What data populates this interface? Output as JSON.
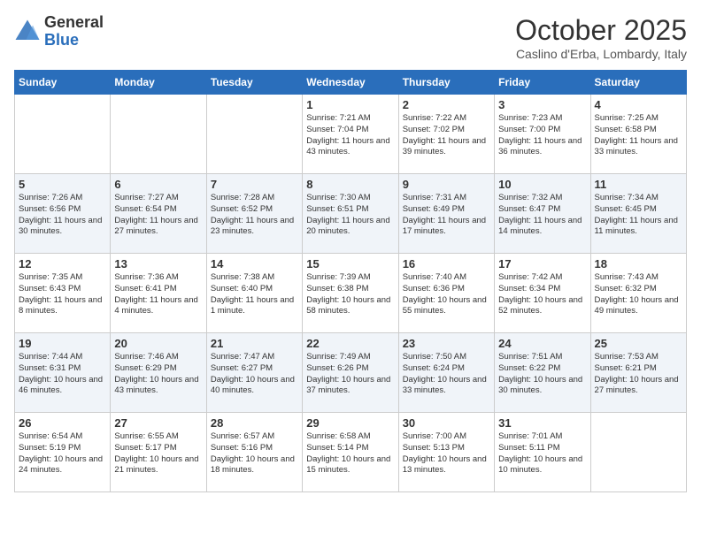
{
  "header": {
    "logo_general": "General",
    "logo_blue": "Blue",
    "month_title": "October 2025",
    "subtitle": "Caslino d'Erba, Lombardy, Italy"
  },
  "weekdays": [
    "Sunday",
    "Monday",
    "Tuesday",
    "Wednesday",
    "Thursday",
    "Friday",
    "Saturday"
  ],
  "weeks": [
    [
      {
        "day": "",
        "sunrise": "",
        "sunset": "",
        "daylight": ""
      },
      {
        "day": "",
        "sunrise": "",
        "sunset": "",
        "daylight": ""
      },
      {
        "day": "",
        "sunrise": "",
        "sunset": "",
        "daylight": ""
      },
      {
        "day": "1",
        "sunrise": "Sunrise: 7:21 AM",
        "sunset": "Sunset: 7:04 PM",
        "daylight": "Daylight: 11 hours and 43 minutes."
      },
      {
        "day": "2",
        "sunrise": "Sunrise: 7:22 AM",
        "sunset": "Sunset: 7:02 PM",
        "daylight": "Daylight: 11 hours and 39 minutes."
      },
      {
        "day": "3",
        "sunrise": "Sunrise: 7:23 AM",
        "sunset": "Sunset: 7:00 PM",
        "daylight": "Daylight: 11 hours and 36 minutes."
      },
      {
        "day": "4",
        "sunrise": "Sunrise: 7:25 AM",
        "sunset": "Sunset: 6:58 PM",
        "daylight": "Daylight: 11 hours and 33 minutes."
      }
    ],
    [
      {
        "day": "5",
        "sunrise": "Sunrise: 7:26 AM",
        "sunset": "Sunset: 6:56 PM",
        "daylight": "Daylight: 11 hours and 30 minutes."
      },
      {
        "day": "6",
        "sunrise": "Sunrise: 7:27 AM",
        "sunset": "Sunset: 6:54 PM",
        "daylight": "Daylight: 11 hours and 27 minutes."
      },
      {
        "day": "7",
        "sunrise": "Sunrise: 7:28 AM",
        "sunset": "Sunset: 6:52 PM",
        "daylight": "Daylight: 11 hours and 23 minutes."
      },
      {
        "day": "8",
        "sunrise": "Sunrise: 7:30 AM",
        "sunset": "Sunset: 6:51 PM",
        "daylight": "Daylight: 11 hours and 20 minutes."
      },
      {
        "day": "9",
        "sunrise": "Sunrise: 7:31 AM",
        "sunset": "Sunset: 6:49 PM",
        "daylight": "Daylight: 11 hours and 17 minutes."
      },
      {
        "day": "10",
        "sunrise": "Sunrise: 7:32 AM",
        "sunset": "Sunset: 6:47 PM",
        "daylight": "Daylight: 11 hours and 14 minutes."
      },
      {
        "day": "11",
        "sunrise": "Sunrise: 7:34 AM",
        "sunset": "Sunset: 6:45 PM",
        "daylight": "Daylight: 11 hours and 11 minutes."
      }
    ],
    [
      {
        "day": "12",
        "sunrise": "Sunrise: 7:35 AM",
        "sunset": "Sunset: 6:43 PM",
        "daylight": "Daylight: 11 hours and 8 minutes."
      },
      {
        "day": "13",
        "sunrise": "Sunrise: 7:36 AM",
        "sunset": "Sunset: 6:41 PM",
        "daylight": "Daylight: 11 hours and 4 minutes."
      },
      {
        "day": "14",
        "sunrise": "Sunrise: 7:38 AM",
        "sunset": "Sunset: 6:40 PM",
        "daylight": "Daylight: 11 hours and 1 minute."
      },
      {
        "day": "15",
        "sunrise": "Sunrise: 7:39 AM",
        "sunset": "Sunset: 6:38 PM",
        "daylight": "Daylight: 10 hours and 58 minutes."
      },
      {
        "day": "16",
        "sunrise": "Sunrise: 7:40 AM",
        "sunset": "Sunset: 6:36 PM",
        "daylight": "Daylight: 10 hours and 55 minutes."
      },
      {
        "day": "17",
        "sunrise": "Sunrise: 7:42 AM",
        "sunset": "Sunset: 6:34 PM",
        "daylight": "Daylight: 10 hours and 52 minutes."
      },
      {
        "day": "18",
        "sunrise": "Sunrise: 7:43 AM",
        "sunset": "Sunset: 6:32 PM",
        "daylight": "Daylight: 10 hours and 49 minutes."
      }
    ],
    [
      {
        "day": "19",
        "sunrise": "Sunrise: 7:44 AM",
        "sunset": "Sunset: 6:31 PM",
        "daylight": "Daylight: 10 hours and 46 minutes."
      },
      {
        "day": "20",
        "sunrise": "Sunrise: 7:46 AM",
        "sunset": "Sunset: 6:29 PM",
        "daylight": "Daylight: 10 hours and 43 minutes."
      },
      {
        "day": "21",
        "sunrise": "Sunrise: 7:47 AM",
        "sunset": "Sunset: 6:27 PM",
        "daylight": "Daylight: 10 hours and 40 minutes."
      },
      {
        "day": "22",
        "sunrise": "Sunrise: 7:49 AM",
        "sunset": "Sunset: 6:26 PM",
        "daylight": "Daylight: 10 hours and 37 minutes."
      },
      {
        "day": "23",
        "sunrise": "Sunrise: 7:50 AM",
        "sunset": "Sunset: 6:24 PM",
        "daylight": "Daylight: 10 hours and 33 minutes."
      },
      {
        "day": "24",
        "sunrise": "Sunrise: 7:51 AM",
        "sunset": "Sunset: 6:22 PM",
        "daylight": "Daylight: 10 hours and 30 minutes."
      },
      {
        "day": "25",
        "sunrise": "Sunrise: 7:53 AM",
        "sunset": "Sunset: 6:21 PM",
        "daylight": "Daylight: 10 hours and 27 minutes."
      }
    ],
    [
      {
        "day": "26",
        "sunrise": "Sunrise: 6:54 AM",
        "sunset": "Sunset: 5:19 PM",
        "daylight": "Daylight: 10 hours and 24 minutes."
      },
      {
        "day": "27",
        "sunrise": "Sunrise: 6:55 AM",
        "sunset": "Sunset: 5:17 PM",
        "daylight": "Daylight: 10 hours and 21 minutes."
      },
      {
        "day": "28",
        "sunrise": "Sunrise: 6:57 AM",
        "sunset": "Sunset: 5:16 PM",
        "daylight": "Daylight: 10 hours and 18 minutes."
      },
      {
        "day": "29",
        "sunrise": "Sunrise: 6:58 AM",
        "sunset": "Sunset: 5:14 PM",
        "daylight": "Daylight: 10 hours and 15 minutes."
      },
      {
        "day": "30",
        "sunrise": "Sunrise: 7:00 AM",
        "sunset": "Sunset: 5:13 PM",
        "daylight": "Daylight: 10 hours and 13 minutes."
      },
      {
        "day": "31",
        "sunrise": "Sunrise: 7:01 AM",
        "sunset": "Sunset: 5:11 PM",
        "daylight": "Daylight: 10 hours and 10 minutes."
      },
      {
        "day": "",
        "sunrise": "",
        "sunset": "",
        "daylight": ""
      }
    ]
  ]
}
